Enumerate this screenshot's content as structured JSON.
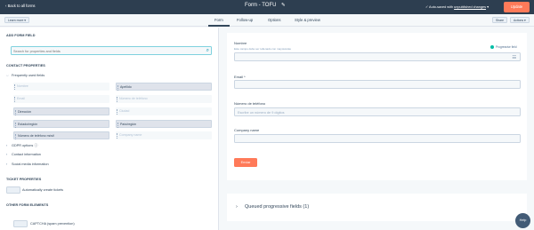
{
  "header": {
    "back_label": "Back to all forms",
    "title": "Form - TOFU",
    "autosave_prefix": "Auto-saved with",
    "autosave_link": "unpublished changes",
    "update_label": "Update"
  },
  "subnav": {
    "left_dropdown": "Learn more ▾",
    "tabs": [
      "Form",
      "Follow-up",
      "Options",
      "Style & preview"
    ],
    "active_tab": "Form",
    "share_label": "Share",
    "actions_label": "Actions ▾"
  },
  "left_panel": {
    "add_form_field_label": "ADD FORM FIELD",
    "search_placeholder": "Search for properties and fields",
    "contact_properties_label": "CONTACT PROPERTIES",
    "frequently_used_label": "Frequently used fields",
    "properties": [
      {
        "label": "Nombre",
        "in_form": false
      },
      {
        "label": "Apellido",
        "in_form": true
      },
      {
        "label": "Email",
        "in_form": false
      },
      {
        "label": "Número de teléfono",
        "in_form": false
      },
      {
        "label": "Dirección",
        "in_form": true
      },
      {
        "label": "Ciudad",
        "in_form": false
      },
      {
        "label": "Estado/región",
        "in_form": true
      },
      {
        "label": "País/región",
        "in_form": true
      },
      {
        "label": "Número de teléfono móvil",
        "in_form": true
      },
      {
        "label": "Company name",
        "in_form": false
      }
    ],
    "gdpr_label": "GDPR options",
    "contact_info_label": "Contact information",
    "social_media_label": "Social media information",
    "ticket_properties_label": "TICKET PROPERTIES",
    "auto_tickets_label": "Automatically create tickets",
    "other_elements_label": "OTHER FORM ELEMENTS",
    "captcha_label": "CAPTCHA (spam prevention)"
  },
  "form_preview": {
    "progressive_label": "Progressive field",
    "fields": [
      {
        "label": "Nombre",
        "help": "Este campo debe ser rellenado con mayúsculas",
        "placeholder": ""
      },
      {
        "label": "Email *",
        "help": "",
        "placeholder": ""
      },
      {
        "label": "Número de teléfono",
        "help": "",
        "placeholder": "Escribe un número de 9 dígitos"
      },
      {
        "label": "Company name",
        "help": "",
        "placeholder": ""
      }
    ],
    "submit_label": "Enviar",
    "queued_label": "Queued progressive fields (1)"
  },
  "help_button": "Help",
  "colors": {
    "header_bg": "#2d3e50",
    "accent_orange": "#ff7a59",
    "progressive_teal": "#00bda5"
  }
}
